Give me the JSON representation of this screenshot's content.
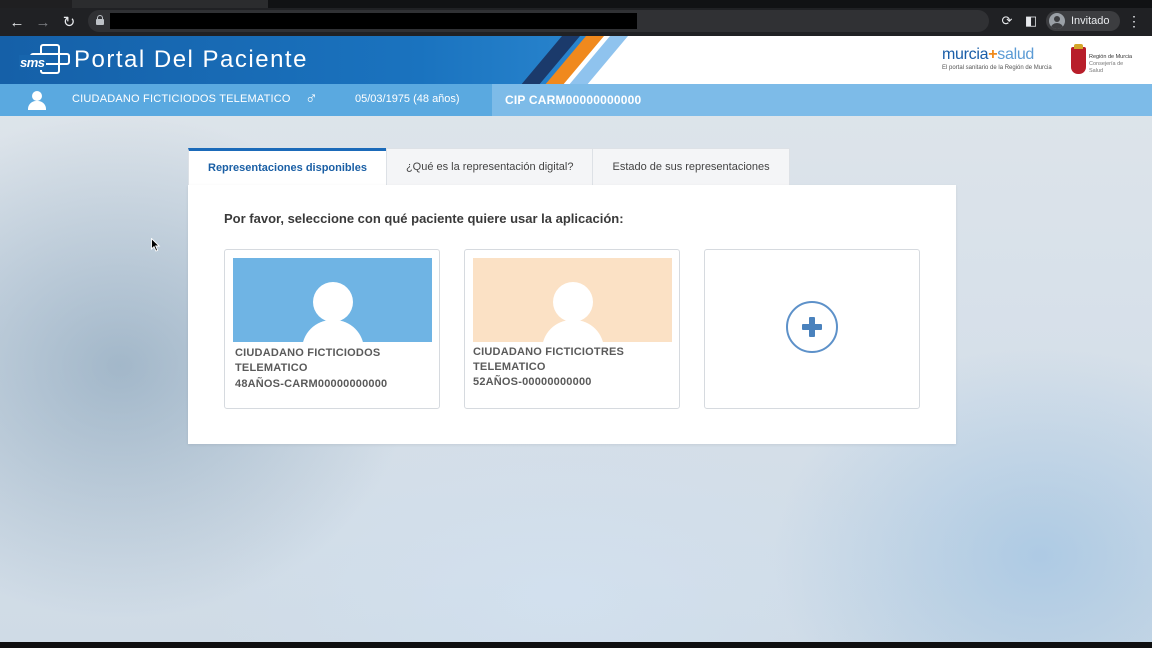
{
  "browser": {
    "profile_label": "Invitado"
  },
  "header": {
    "brand_short": "sms",
    "title": "Portal Del Paciente",
    "partner_logo": {
      "main_left": "murcia",
      "main_right": "salud",
      "tagline": "El portal sanitario de la Región de Murcia"
    },
    "region_logo": {
      "line1": "Región de Murcia",
      "line2": "Consejería de Salud"
    },
    "stripe_colors": [
      "#1b3a6b",
      "#f0891d",
      "#8fc3ee"
    ]
  },
  "patient_bar": {
    "name": "CIUDADANO FICTICIODOS TELEMATICO",
    "gender_symbol": "♂",
    "birth": "05/03/1975 (48 años)",
    "cip": "CIP CARM00000000000"
  },
  "tabs": [
    {
      "label": "Representaciones disponibles",
      "active": true
    },
    {
      "label": "¿Qué es la representación digital?",
      "active": false
    },
    {
      "label": "Estado de sus representaciones",
      "active": false
    }
  ],
  "main": {
    "prompt": "Por favor, seleccione con qué paciente quiere usar la aplicación:",
    "patients": [
      {
        "name_line1": "CIUDADANO FICTICIODOS",
        "name_line2": "TELEMATICO",
        "age_id": "48AÑOS-CARM00000000000",
        "photo_color": "#6fb4e4"
      },
      {
        "name_line1": "CIUDADANO FICTICIOTRES",
        "name_line2": "TELEMATICO",
        "age_id": "52AÑOS-00000000000",
        "photo_color": "#fbe1c5"
      }
    ],
    "add_card_icon": "plus-circle-icon"
  },
  "colors": {
    "header_blue": "#1a6db8",
    "patient_bar": "#5aa9e0",
    "tab_active": "#1a5fa5"
  }
}
